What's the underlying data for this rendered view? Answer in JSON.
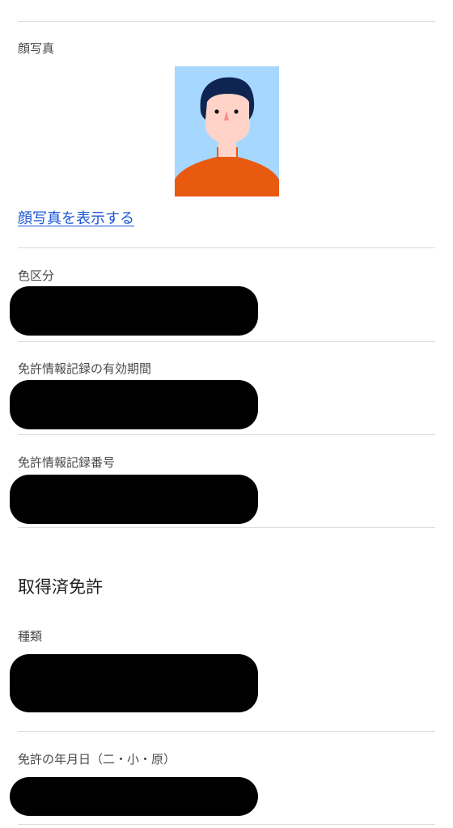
{
  "photo_section": {
    "label": "顔写真",
    "link_text": "顔写真を表示する"
  },
  "fields": {
    "color_category": {
      "label": "色区分",
      "value": ""
    },
    "validity_period": {
      "label": "免許情報記録の有効期間",
      "value": ""
    },
    "record_number": {
      "label": "免許情報記録番号",
      "value": ""
    }
  },
  "acquired_licenses": {
    "title": "取得済免許",
    "type_label": "種類",
    "date_label": "免許の年月日（二・小・原）"
  },
  "colors": {
    "photo_bg": "#a6d8ff",
    "hair": "#0f2450",
    "skin": "#ffd3c8",
    "shirt": "#e85a10",
    "link": "#1a56d6"
  },
  "icons": {
    "photo": "portrait-illustration-icon"
  }
}
